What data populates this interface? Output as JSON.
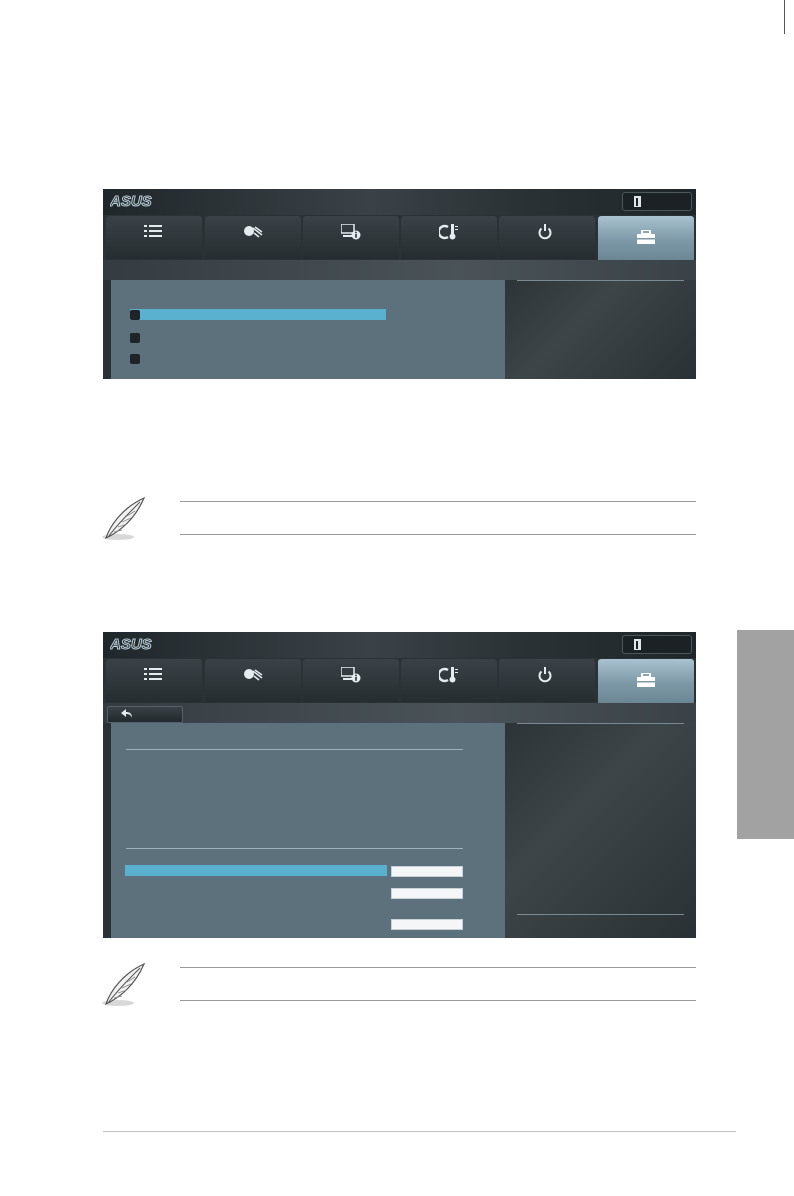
{
  "brand": "ASUS",
  "colors": {
    "highlight": "#5ab0cf",
    "panel_main": "#5c717b",
    "panel_dark": "#2b3135",
    "active_tab": "#8fabb9",
    "chapter_tab": "#a2a2a2"
  },
  "tabs": [
    {
      "icon": "list-icon"
    },
    {
      "icon": "cpu-icon"
    },
    {
      "icon": "system-info-icon"
    },
    {
      "icon": "temperature-icon"
    },
    {
      "icon": "power-icon"
    },
    {
      "icon": "toolbox-icon",
      "active": true
    }
  ],
  "screens": [
    {
      "items": [
        {
          "checkbox": true,
          "highlighted": true
        },
        {
          "checkbox": true,
          "highlighted": false
        },
        {
          "checkbox": true,
          "highlighted": false
        }
      ]
    },
    {
      "back_button": true,
      "value_fields": 3
    }
  ],
  "notes": [
    {
      "icon": "quill-note-icon"
    },
    {
      "icon": "quill-note-icon"
    }
  ]
}
